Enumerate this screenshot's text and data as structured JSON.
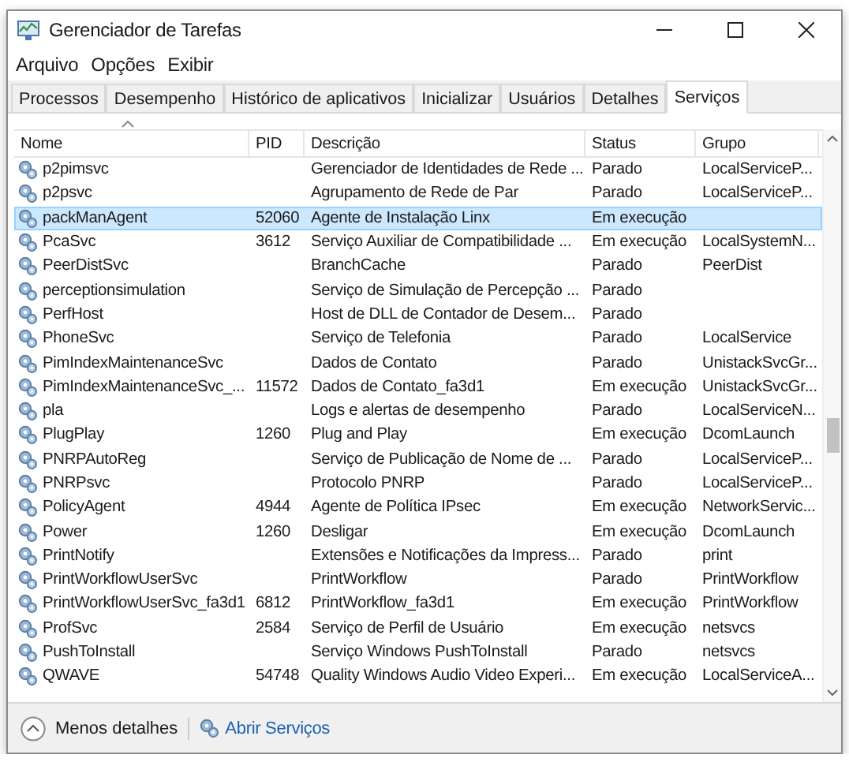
{
  "window": {
    "title": "Gerenciador de Tarefas"
  },
  "menu": [
    "Arquivo",
    "Opções",
    "Exibir"
  ],
  "tabs": [
    {
      "label": "Processos",
      "selected": false
    },
    {
      "label": "Desempenho",
      "selected": false
    },
    {
      "label": "Histórico de aplicativos",
      "selected": false
    },
    {
      "label": "Inicializar",
      "selected": false
    },
    {
      "label": "Usuários",
      "selected": false
    },
    {
      "label": "Detalhes",
      "selected": false
    },
    {
      "label": "Serviços",
      "selected": true
    }
  ],
  "table": {
    "columns": [
      "Nome",
      "PID",
      "Descrição",
      "Status",
      "Grupo"
    ],
    "rows": [
      {
        "name": "p2pimsvc",
        "pid": "",
        "description": "Gerenciador de Identidades de Rede ...",
        "status": "Parado",
        "group": "LocalServiceP...",
        "selected": false
      },
      {
        "name": "p2psvc",
        "pid": "",
        "description": "Agrupamento de Rede de Par",
        "status": "Parado",
        "group": "LocalServiceP...",
        "selected": false
      },
      {
        "name": "packManAgent",
        "pid": "52060",
        "description": "Agente de Instalação Linx",
        "status": "Em execução",
        "group": "",
        "selected": true
      },
      {
        "name": "PcaSvc",
        "pid": "3612",
        "description": "Serviço Auxiliar de Compatibilidade ...",
        "status": "Em execução",
        "group": "LocalSystemN...",
        "selected": false
      },
      {
        "name": "PeerDistSvc",
        "pid": "",
        "description": "BranchCache",
        "status": "Parado",
        "group": "PeerDist",
        "selected": false
      },
      {
        "name": "perceptionsimulation",
        "pid": "",
        "description": "Serviço de Simulação de Percepção ...",
        "status": "Parado",
        "group": "",
        "selected": false
      },
      {
        "name": "PerfHost",
        "pid": "",
        "description": "Host de DLL de Contador de Desem...",
        "status": "Parado",
        "group": "",
        "selected": false
      },
      {
        "name": "PhoneSvc",
        "pid": "",
        "description": "Serviço de Telefonia",
        "status": "Parado",
        "group": "LocalService",
        "selected": false
      },
      {
        "name": "PimIndexMaintenanceSvc",
        "pid": "",
        "description": "Dados de Contato",
        "status": "Parado",
        "group": "UnistackSvcGr...",
        "selected": false
      },
      {
        "name": "PimIndexMaintenanceSvc_...",
        "pid": "11572",
        "description": "Dados de Contato_fa3d1",
        "status": "Em execução",
        "group": "UnistackSvcGr...",
        "selected": false
      },
      {
        "name": "pla",
        "pid": "",
        "description": "Logs e alertas de desempenho",
        "status": "Parado",
        "group": "LocalServiceN...",
        "selected": false
      },
      {
        "name": "PlugPlay",
        "pid": "1260",
        "description": "Plug and Play",
        "status": "Em execução",
        "group": "DcomLaunch",
        "selected": false
      },
      {
        "name": "PNRPAutoReg",
        "pid": "",
        "description": "Serviço de Publicação de Nome de ...",
        "status": "Parado",
        "group": "LocalServiceP...",
        "selected": false
      },
      {
        "name": "PNRPsvc",
        "pid": "",
        "description": "Protocolo PNRP",
        "status": "Parado",
        "group": "LocalServiceP...",
        "selected": false
      },
      {
        "name": "PolicyAgent",
        "pid": "4944",
        "description": "Agente de Política IPsec",
        "status": "Em execução",
        "group": "NetworkServic...",
        "selected": false
      },
      {
        "name": "Power",
        "pid": "1260",
        "description": "Desligar",
        "status": "Em execução",
        "group": "DcomLaunch",
        "selected": false
      },
      {
        "name": "PrintNotify",
        "pid": "",
        "description": "Extensões e Notificações da Impress...",
        "status": "Parado",
        "group": "print",
        "selected": false
      },
      {
        "name": "PrintWorkflowUserSvc",
        "pid": "",
        "description": "PrintWorkflow",
        "status": "Parado",
        "group": "PrintWorkflow",
        "selected": false
      },
      {
        "name": "PrintWorkflowUserSvc_fa3d1",
        "pid": "6812",
        "description": "PrintWorkflow_fa3d1",
        "status": "Em execução",
        "group": "PrintWorkflow",
        "selected": false
      },
      {
        "name": "ProfSvc",
        "pid": "2584",
        "description": "Serviço de Perfil de Usuário",
        "status": "Em execução",
        "group": "netsvcs",
        "selected": false
      },
      {
        "name": "PushToInstall",
        "pid": "",
        "description": "Serviço Windows PushToInstall",
        "status": "Parado",
        "group": "netsvcs",
        "selected": false
      },
      {
        "name": "QWAVE",
        "pid": "54748",
        "description": "Quality Windows Audio Video Experi...",
        "status": "Em execução",
        "group": "LocalServiceA...",
        "selected": false
      }
    ]
  },
  "footer": {
    "less_details": "Menos detalhes",
    "open_services": "Abrir Serviços"
  }
}
